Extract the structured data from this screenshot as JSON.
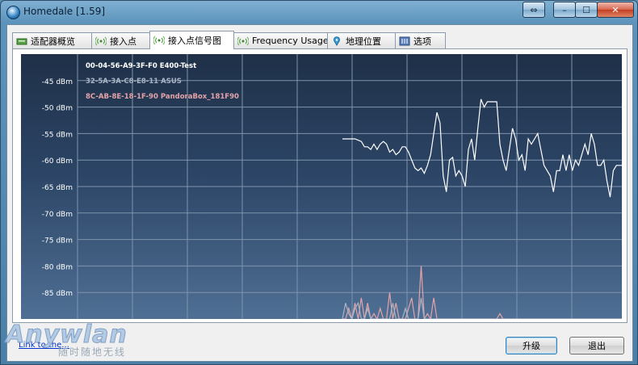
{
  "window": {
    "title": "Homedale [1.59]"
  },
  "titlebar_buttons": {
    "restore": "⇔",
    "minimize": "–",
    "maximize": "☐",
    "close": "✕"
  },
  "tabs": [
    {
      "label": "适配器概览",
      "icon": "adapter-icon"
    },
    {
      "label": "接入点",
      "icon": "antenna-icon"
    },
    {
      "label": "接入点信号图",
      "icon": "antenna-icon",
      "active": true
    },
    {
      "label": "Frequency Usage",
      "icon": "antenna-icon"
    },
    {
      "label": "地理位置",
      "icon": "map-pin-icon"
    },
    {
      "label": "选项",
      "icon": "options-icon"
    }
  ],
  "chart_data": {
    "type": "line",
    "ylim": [
      -90,
      -40
    ],
    "y_ticks": [
      "-45 dBm",
      "-50 dBm",
      "-55 dBm",
      "-60 dBm",
      "-65 dBm",
      "-70 dBm",
      "-75 dBm",
      "-80 dBm",
      "-85 dBm"
    ],
    "y_tick_values": [
      -45,
      -50,
      -55,
      -60,
      -65,
      -70,
      -75,
      -80,
      -85
    ],
    "grid": true,
    "series": [
      {
        "name": "00-04-56-A9-3F-F0 E400-Test",
        "color": "#ffffff",
        "x": [
          0,
          4,
          6,
          7,
          8,
          9,
          10,
          11,
          12,
          13,
          14,
          15,
          16,
          17,
          18,
          19,
          20,
          21,
          22,
          23,
          24,
          25,
          26,
          27,
          28,
          29,
          30,
          31,
          32,
          33,
          34,
          35,
          36,
          37,
          38,
          39,
          40,
          41,
          42,
          43,
          44,
          45,
          46,
          47,
          48,
          49,
          50,
          51,
          52,
          53,
          54,
          55,
          56,
          57,
          58,
          59,
          60,
          61,
          62,
          63,
          64,
          65,
          66,
          67,
          68,
          69,
          70,
          71,
          72,
          73,
          74,
          75,
          76,
          77,
          78,
          79,
          80,
          81,
          82,
          83,
          84,
          85,
          86,
          87,
          88,
          89
        ],
        "values": [
          -56,
          -56,
          -56.5,
          -57.5,
          -57.5,
          -58,
          -57,
          -58,
          -57,
          -56.5,
          -57,
          -58.5,
          -58,
          -59,
          -58.5,
          -57.5,
          -57.5,
          -58.5,
          -60,
          -61.5,
          -62,
          -61.5,
          -62.5,
          -61,
          -59,
          -55,
          -51,
          -53,
          -63,
          -66,
          -60,
          -59.5,
          -63,
          -62,
          -63,
          -65,
          -58,
          -56,
          -60,
          -54,
          -48.5,
          -50,
          -49,
          -49,
          -49,
          -49,
          -57,
          -60,
          -62,
          -58,
          -54,
          -56,
          -60,
          -59,
          -62,
          -56,
          -57,
          -56,
          -55,
          -58,
          -61,
          -62,
          -63,
          -66,
          -62,
          -62,
          -59,
          -62,
          -59,
          -62,
          -60,
          -61,
          -59,
          -57,
          -59,
          -55,
          -57,
          -61,
          -61,
          -60,
          -64,
          -67,
          -62,
          -61,
          -61,
          -61
        ]
      },
      {
        "name": "32-5A-3A-C8-E8-11 ASUS",
        "color": "#aab4c4",
        "x": [
          0,
          1,
          2,
          3,
          4,
          5,
          6,
          7,
          8,
          9,
          10,
          11,
          12,
          13,
          14,
          15,
          16,
          17,
          18,
          19,
          20,
          21,
          22,
          23,
          24,
          25,
          26,
          27,
          28,
          29,
          30,
          31,
          32,
          33,
          34,
          35,
          36,
          37,
          38,
          39,
          40,
          41,
          42,
          43,
          44,
          45,
          46,
          47,
          48,
          49,
          50,
          51,
          52,
          53,
          54,
          55,
          56,
          57,
          58,
          59,
          60,
          61,
          62,
          63,
          64,
          65,
          66,
          67,
          68,
          69,
          70,
          71,
          72,
          73,
          74,
          75,
          76,
          77,
          78,
          79,
          80,
          81,
          82,
          83,
          84,
          85,
          86,
          87,
          88,
          89
        ],
        "values": [
          -90,
          -87,
          -89,
          -90,
          -88,
          -87,
          -90,
          -90,
          -88,
          -90,
          -90,
          -90,
          -90,
          -90,
          -90,
          -90,
          -87,
          -90,
          -90,
          -90,
          -88,
          -90,
          -90,
          -90,
          -90,
          -86,
          -90,
          -90,
          -90,
          -90,
          -90,
          -90,
          -90,
          -90,
          -90,
          -90,
          -90,
          -90,
          -90,
          -90,
          -90,
          -90,
          -90,
          -90,
          -90,
          -90,
          -90,
          -90,
          -90,
          -90,
          -90,
          -90,
          -90,
          -90,
          -90,
          -90,
          -90,
          -90,
          -90,
          -90,
          -90,
          -90,
          -90,
          -90,
          -90,
          -90,
          -90,
          -90,
          -90,
          -90,
          -90,
          -90,
          -90,
          -90,
          -90,
          -90,
          -90,
          -90,
          -90,
          -90,
          -90,
          -90,
          -90,
          -90,
          -90,
          -90,
          -90,
          -90,
          -90,
          -90
        ]
      },
      {
        "name": "8C-AB-8E-18-1F-90 PandoraBox_181F90",
        "color": "#e3a3a8",
        "x": [
          0,
          1,
          2,
          3,
          4,
          5,
          6,
          7,
          8,
          9,
          10,
          11,
          12,
          13,
          14,
          15,
          16,
          17,
          18,
          19,
          20,
          21,
          22,
          23,
          24,
          25,
          26,
          27,
          28,
          29,
          30,
          31,
          32,
          33,
          34,
          35,
          36,
          37,
          38,
          39,
          40,
          41,
          42,
          43,
          44,
          45,
          46,
          47,
          48,
          49,
          50,
          51,
          52,
          53,
          54,
          55,
          56,
          57,
          58,
          59,
          60,
          61,
          62,
          63,
          64,
          65,
          66,
          67,
          68,
          69,
          70,
          71,
          72,
          73,
          74,
          75,
          76,
          77,
          78,
          79,
          80,
          81,
          82,
          83,
          84,
          85,
          86,
          87,
          88,
          89
        ],
        "values": [
          -90,
          -90,
          -88,
          -90,
          -87,
          -90,
          -86,
          -90,
          -87,
          -90,
          -89,
          -90,
          -88,
          -90,
          -90,
          -85,
          -90,
          -87,
          -90,
          -90,
          -90,
          -88,
          -86,
          -90,
          -90,
          -80,
          -90,
          -89,
          -90,
          -86,
          -90,
          -90,
          -90,
          -90,
          -90,
          -90,
          -90,
          -90,
          -90,
          -90,
          -90,
          -90,
          -90,
          -90,
          -90,
          -90,
          -90,
          -90,
          -90,
          -90,
          -89,
          -90,
          -90,
          -90,
          -90,
          -90,
          -90,
          -90,
          -90,
          -90,
          -90,
          -90,
          -90,
          -90,
          -90,
          -90,
          -90,
          -90,
          -90,
          -90,
          -90,
          -90,
          -90,
          -90,
          -90,
          -90,
          -90,
          -90,
          -90,
          -90,
          -90,
          -90,
          -90,
          -90,
          -90,
          -90,
          -90,
          -90,
          -90,
          -90
        ]
      }
    ]
  },
  "footer": {
    "link_text": "Link to the...",
    "upgrade_label": "升级",
    "exit_label": "退出"
  },
  "watermark": {
    "main": "Anywlan",
    "sub": "随时随地无线"
  }
}
